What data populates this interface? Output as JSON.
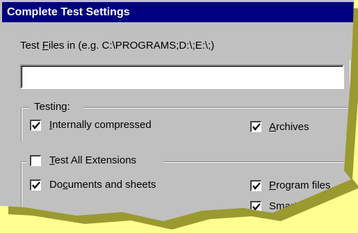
{
  "window": {
    "title": "Complete Test Settings"
  },
  "files": {
    "label_prefix": "Test ",
    "label_mnemonic": "F",
    "label_suffix": "iles in (e.g. C:\\PROGRAMS;D:\\;E:\\;)",
    "value": ""
  },
  "testing": {
    "group_label": "Testing:",
    "internally_compressed": {
      "mnemonic": "I",
      "rest": "nternally compressed",
      "checked": true
    },
    "archives": {
      "mnemonic": "A",
      "rest": "rchives",
      "checked": true
    }
  },
  "extensions": {
    "test_all": {
      "mnemonic": "T",
      "rest": "est All Extensions",
      "checked": false
    },
    "documents": {
      "prefix": "Do",
      "mnemonic": "c",
      "rest": "uments and sheets",
      "checked": true
    },
    "program_files": {
      "mnemonic": "P",
      "rest": "rogram files",
      "checked": true
    },
    "smart_scan": {
      "label": "Smart Scan",
      "checked": true
    }
  }
}
